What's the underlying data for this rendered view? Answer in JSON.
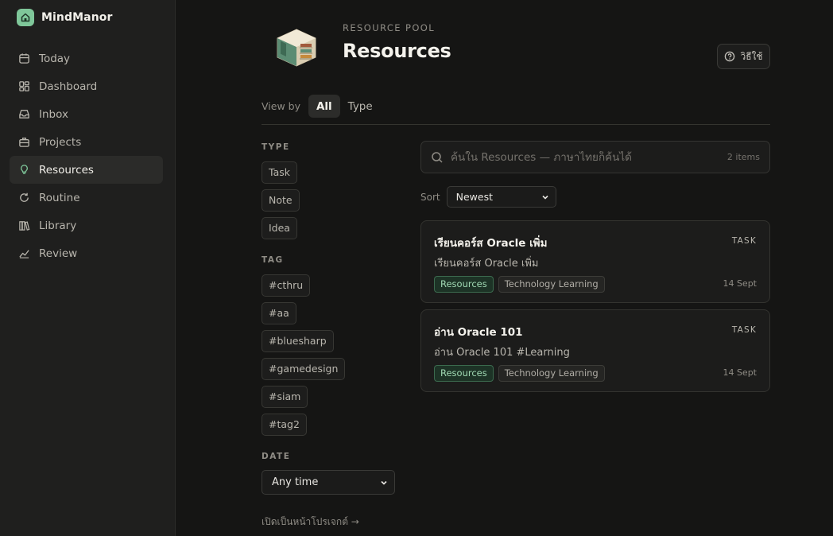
{
  "app": {
    "name": "MindManor",
    "accent": "#7fc79a"
  },
  "sidebar": {
    "items": [
      {
        "label": "Today",
        "icon": "calendar-icon",
        "active": false
      },
      {
        "label": "Dashboard",
        "icon": "dashboard-icon",
        "active": false
      },
      {
        "label": "Inbox",
        "icon": "inbox-icon",
        "active": false
      },
      {
        "label": "Projects",
        "icon": "briefcase-icon",
        "active": false
      },
      {
        "label": "Resources",
        "icon": "lightbulb-icon",
        "active": true
      },
      {
        "label": "Routine",
        "icon": "refresh-icon",
        "active": false
      },
      {
        "label": "Library",
        "icon": "books-icon",
        "active": false
      },
      {
        "label": "Review",
        "icon": "chart-icon",
        "active": false
      }
    ]
  },
  "header": {
    "eyebrow": "RESOURCE POOL",
    "title": "Resources",
    "help_label": "วิธีใช้"
  },
  "viewby": {
    "label": "View by",
    "tabs": [
      {
        "label": "All",
        "active": true
      },
      {
        "label": "Type",
        "active": false
      }
    ]
  },
  "filters": {
    "type_heading": "TYPE",
    "types": [
      "Task",
      "Note",
      "Idea"
    ],
    "tag_heading": "TAG",
    "tags": [
      "#cthru",
      "#aa",
      "#bluesharp",
      "#gamedesign",
      "#siam",
      "#tag2"
    ],
    "date_heading": "DATE",
    "date_value": "Any time",
    "project_link": "เปิดเป็นหน้าโปรเจกต์ →"
  },
  "search": {
    "placeholder": "ค้นใน Resources — ภาษาไทยก็ค้นได้",
    "count": "2 items"
  },
  "sort": {
    "label": "Sort",
    "value": "Newest"
  },
  "cards": [
    {
      "title": "เรียนคอร์ส Oracle เพิ่ม",
      "type": "TASK",
      "desc": "เรียนคอร์ส Oracle เพิ่ม",
      "tags": [
        "Resources",
        "Technology Learning"
      ],
      "date": "14 Sept"
    },
    {
      "title": "อ่าน Oracle 101",
      "type": "TASK",
      "desc": "อ่าน Oracle 101 #Learning",
      "tags": [
        "Resources",
        "Technology Learning"
      ],
      "date": "14 Sept"
    }
  ]
}
